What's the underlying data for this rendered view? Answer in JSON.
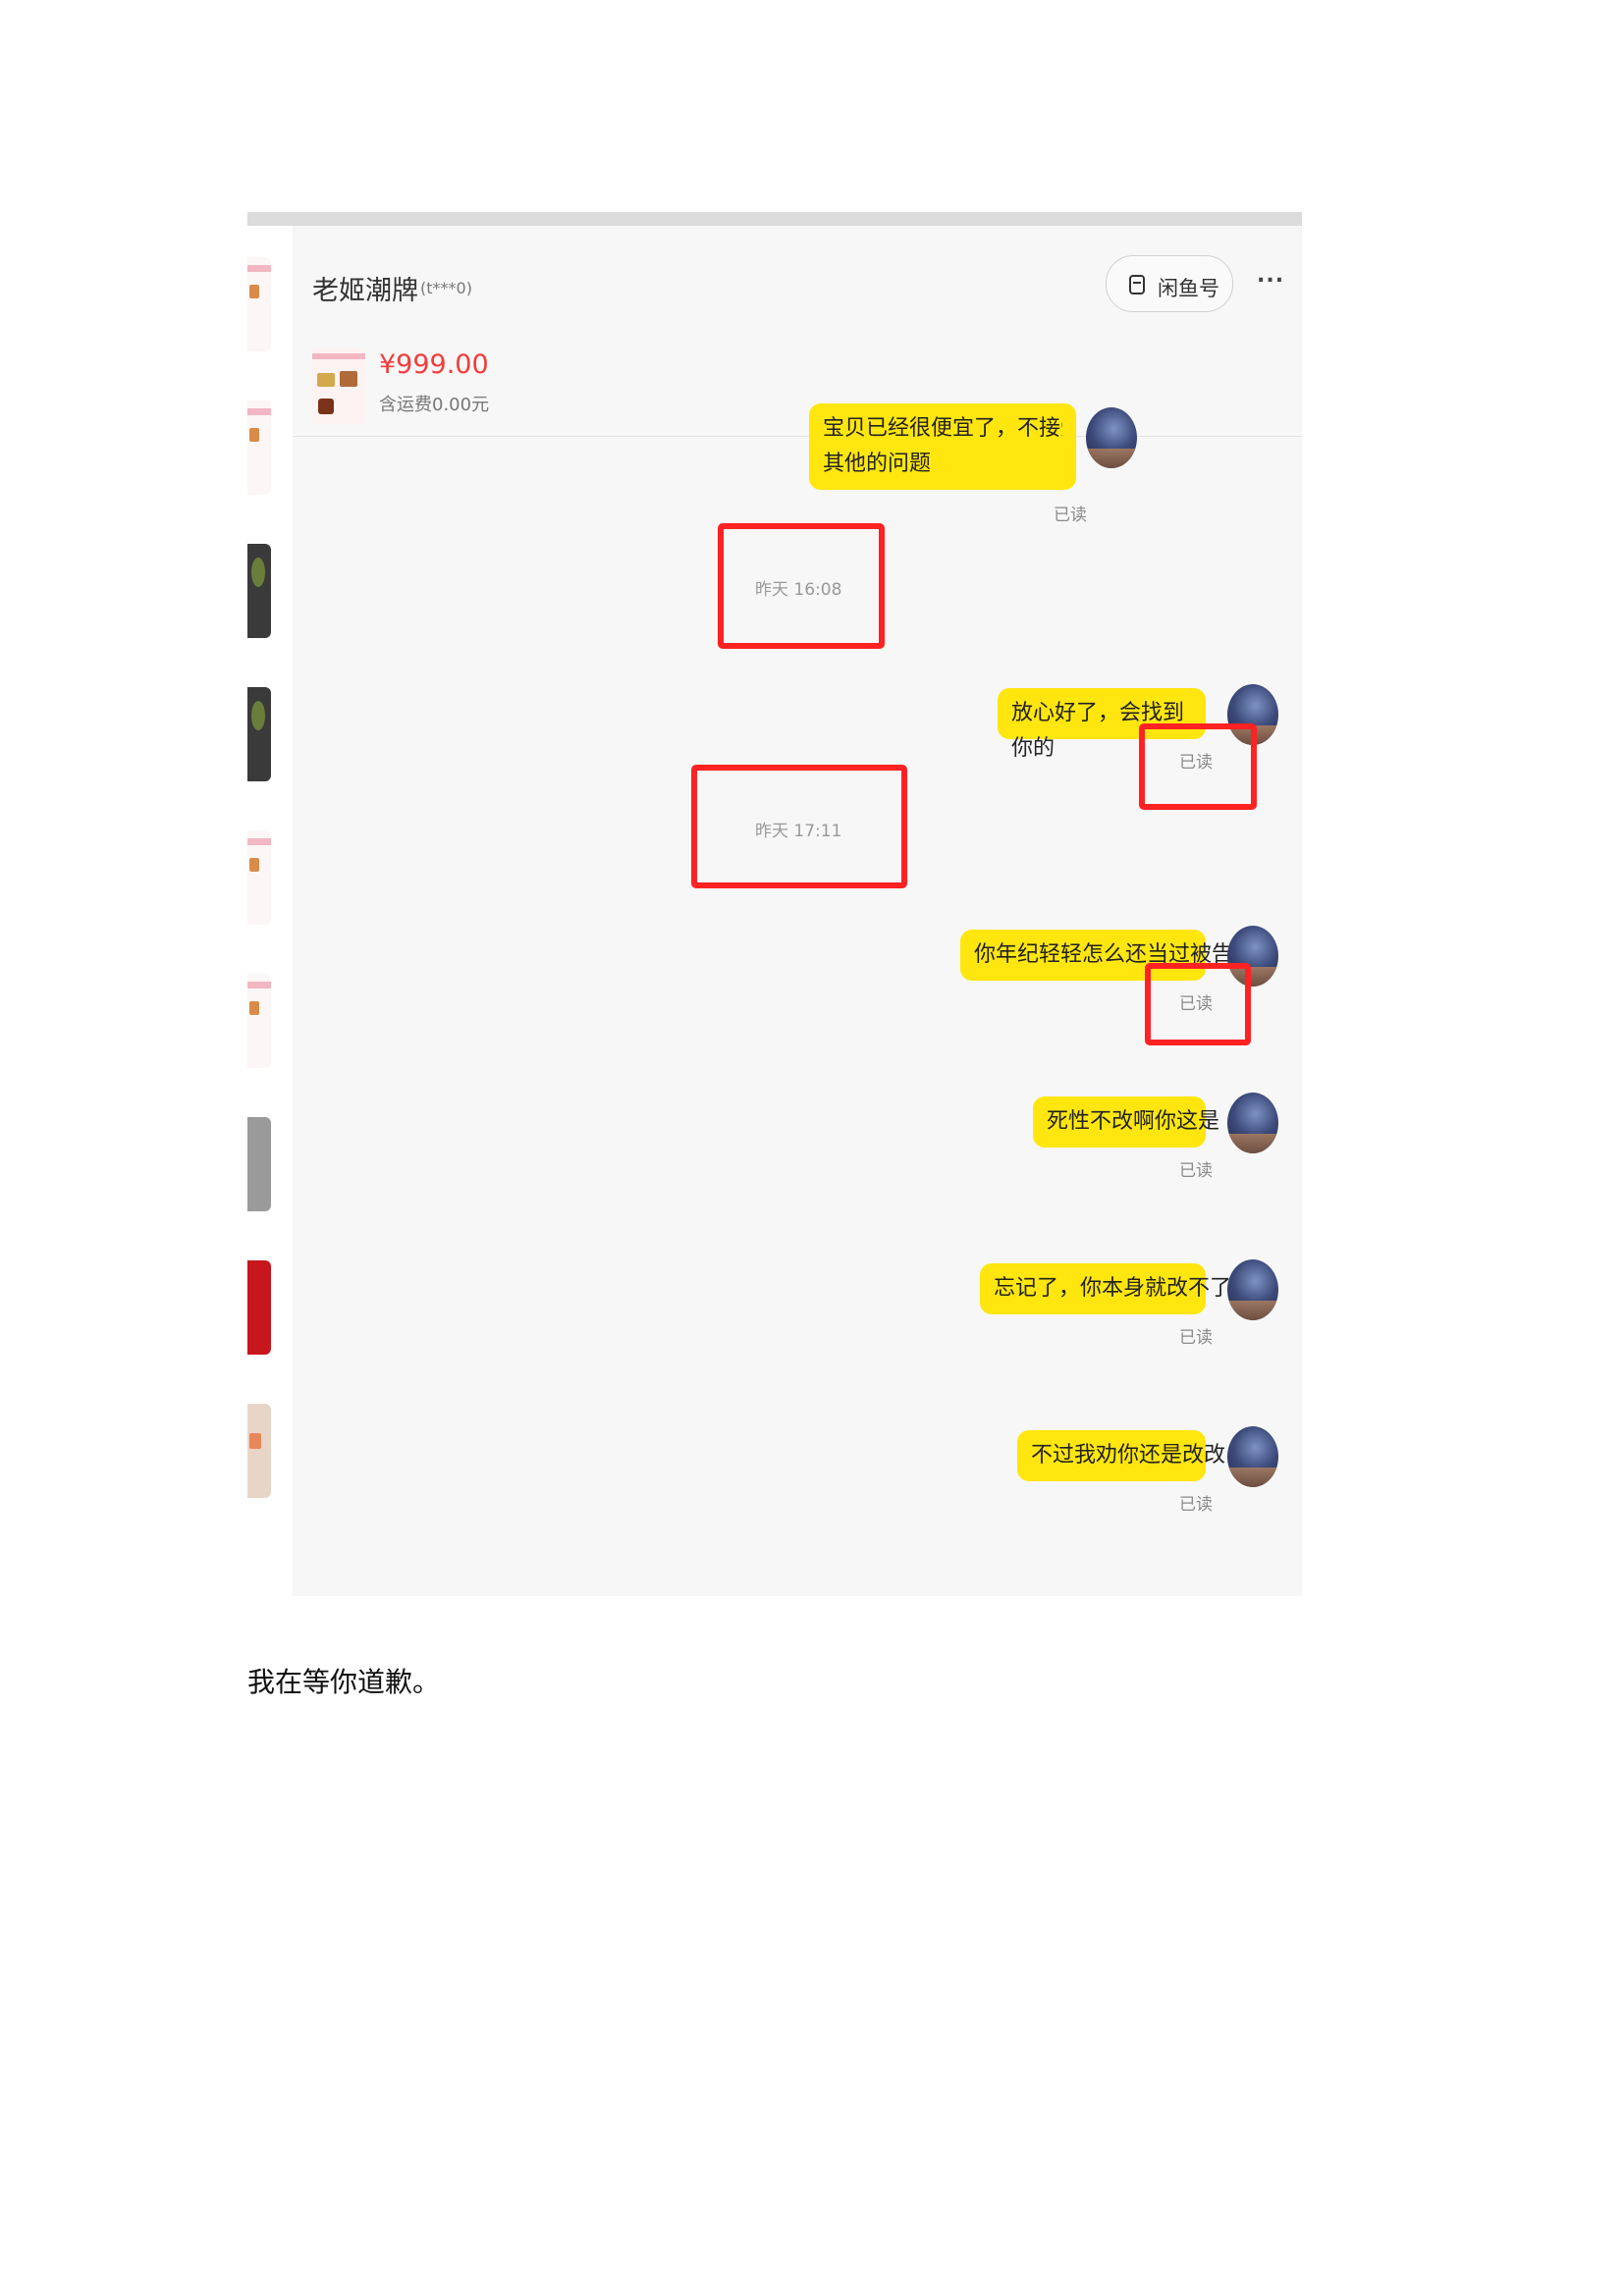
{
  "chat": {
    "seller_name": "老姬潮牌",
    "seller_sub": "(t***0)",
    "xianyu_button": "闲鱼号",
    "more_button": "...",
    "product": {
      "price": "¥999.00",
      "shipping": "含运费0.00元"
    },
    "messages": [
      {
        "text_line1": "宝贝已经很便宜了，不接受议价哦～欢迎询问",
        "text_line2": "其他的问题",
        "status": "已读"
      },
      {
        "timestamp": "昨天 16:08"
      },
      {
        "text": "放心好了，会找到你的",
        "status": "已读"
      },
      {
        "timestamp": "昨天 17:11"
      },
      {
        "text": "你年纪轻轻怎么还当过被告",
        "status": "已读"
      },
      {
        "text": "死性不改啊你这是",
        "status": "已读"
      },
      {
        "text": "忘记了，你本身就改不了",
        "status": "已读"
      },
      {
        "text": "不过我劝你还是改改",
        "status": "已读"
      }
    ]
  },
  "document": {
    "caption": "我在等你道歉。"
  },
  "colors": {
    "bubble": "#ffe60f",
    "price": "#f23c3c",
    "highlight_box": "#ff2222"
  }
}
